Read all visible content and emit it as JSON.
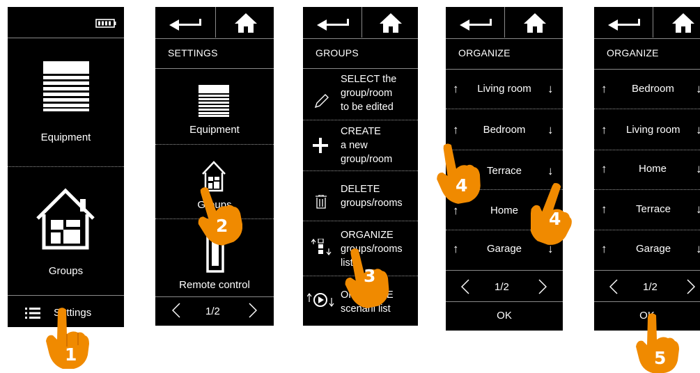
{
  "colors": {
    "screen_bg": "#000000",
    "text": "#ffffff",
    "hand": "#f08a00",
    "divider": "#9a9a9a"
  },
  "screen1": {
    "battery_icon": "battery-icon",
    "equipment_label": "Equipment",
    "groups_label": "Groups",
    "settings_label": "Settings",
    "menu_icon": "list-menu-icon"
  },
  "screen2": {
    "title": "SETTINGS",
    "equipment_label": "Equipment",
    "groups_label": "Groups",
    "remote_label": "Remote control",
    "page_indicator": "1/2",
    "prev": "<",
    "next": ">"
  },
  "screen3": {
    "title": "GROUPS",
    "items": [
      {
        "icon": "pencil-icon",
        "lines": [
          "SELECT the",
          "group/room",
          "to be edited"
        ]
      },
      {
        "icon": "plus-icon",
        "lines": [
          "CREATE",
          "a new",
          "group/room"
        ]
      },
      {
        "icon": "trash-icon",
        "lines": [
          "DELETE",
          "groups/rooms"
        ]
      },
      {
        "icon": "organize-list-icon",
        "lines": [
          "ORGANIZE",
          "groups/rooms",
          "list"
        ]
      },
      {
        "icon": "organize-scenario-icon",
        "lines": [
          "ORGANIZE",
          "scenarii list"
        ]
      }
    ]
  },
  "screen4": {
    "title": "ORGANIZE",
    "rows": [
      "Living room",
      "Bedroom",
      "Terrace",
      "Home",
      "Garage"
    ],
    "page_indicator": "1/2",
    "prev": "<",
    "next": ">",
    "ok": "OK",
    "up": "↑",
    "down": "↓"
  },
  "screen5": {
    "title": "ORGANIZE",
    "rows": [
      "Bedroom",
      "Living room",
      "Home",
      "Terrace",
      "Garage"
    ],
    "page_indicator": "1/2",
    "prev": "<",
    "next": ">",
    "ok": "OK",
    "up": "↑",
    "down": "↓"
  },
  "steps": [
    "1",
    "2",
    "3",
    "4",
    "4",
    "5"
  ]
}
